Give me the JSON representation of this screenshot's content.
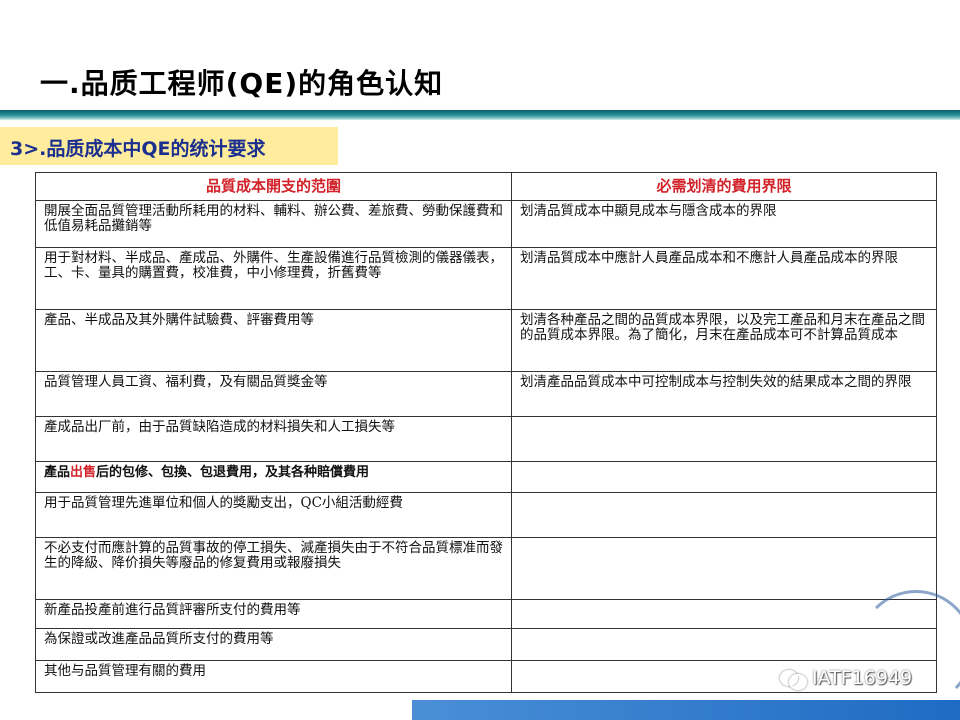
{
  "header": {
    "title": "一.品质工程师(QE)的角色认知",
    "subtitle": "3>.品质成本中QE的统计要求"
  },
  "table": {
    "headers": [
      "品質成本開支的范圍",
      "必需划清的費用界限"
    ],
    "rows": [
      [
        "開展全面品質管理活動所耗用的材料、輔料、辦公費、差旅費、勞動保護費和低值易耗品攤銷等",
        "划清品質成本中顯見成本与隱含成本的界限"
      ],
      [
        "用于對材料、半成品、產成品、外購件、生產設備進行品質檢測的儀器儀表，工、卡、量具的購置費，校准費，中小修理費，折舊費等",
        "划清品質成本中應計人員產品成本和不應計人員產品成本的界限"
      ],
      [
        "產品、半成品及其外購件試驗費、評審費用等",
        "划清各种產品之間的品質成本界限，以及完工產品和月末在產品之間的品質成本界限。為了簡化，月末在產品成本可不計算品質成本"
      ],
      [
        "品質管理人員工資、福利費，及有關品質獎金等",
        "划清產品品質成本中可控制成本与控制失效的結果成本之間的界限"
      ],
      [
        "產成品出厂前，由于品質缺陷造成的材料損失和人工損失等",
        ""
      ],
      [
        "",
        ""
      ],
      [
        "用于品質管理先進單位和個人的獎勵支出，QC小組活動經費",
        ""
      ],
      [
        "不必支付而應計算的品質事故的停工損失、減產損失由于不符合品質標准而發生的降級、降价損失等廢品的修复費用或報廢損失",
        ""
      ],
      [
        "新產品投產前進行品質評審所支付的費用等",
        ""
      ],
      [
        "為保證或改進產品品質所支付的費用等",
        ""
      ],
      [
        "其他与品質管理有關的費用",
        ""
      ]
    ],
    "special_row": {
      "prefix": "產品",
      "highlight": "出售",
      "suffix": "后的包修、包換、包退費用，及其各种賠償費用"
    }
  },
  "watermark": {
    "text": "IATF16949",
    "icon": "wechat-icon"
  },
  "colors": {
    "header_text": "#d2232a",
    "subtitle_text": "#1b2f8f",
    "subtitle_bg": "#ffec9c",
    "rule": "#1f8c94"
  }
}
